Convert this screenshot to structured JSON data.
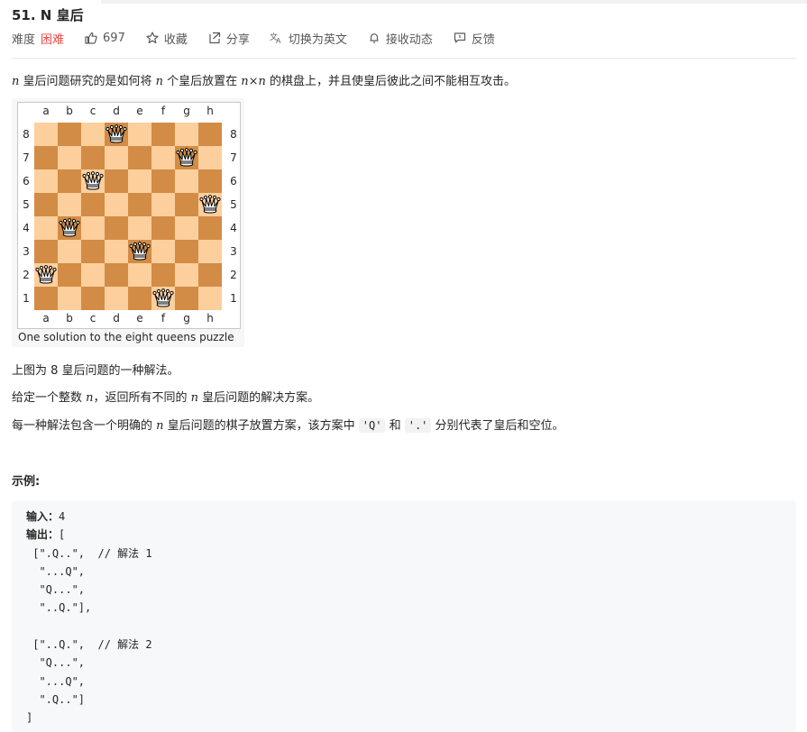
{
  "problem": {
    "title": "51. N 皇后",
    "difficulty_label": "难度",
    "difficulty_value": "困难",
    "likes": "697",
    "favorite": "收藏",
    "share": "分享",
    "translate": "切换为英文",
    "subscribe": "接收动态",
    "feedback": "反馈"
  },
  "description": {
    "p1_a": "n",
    "p1_b": " 皇后问题研究的是如何将 ",
    "p1_c": "n",
    "p1_d": " 个皇后放置在 ",
    "p1_e": "n×n",
    "p1_f": " 的棋盘上，并且使皇后彼此之间不能相互攻击。",
    "p2": "上图为 8 皇后问题的一种解法。",
    "p3_a": "给定一个整数 ",
    "p3_b": "n",
    "p3_c": "，返回所有不同的 ",
    "p3_d": "n",
    "p3_e": " 皇后问题的解决方案。",
    "p4_a": "每一种解法包含一个明确的 ",
    "p4_b": "n",
    "p4_c": " 皇后问题的棋子放置方案，该方案中 ",
    "p4_code1": "'Q'",
    "p4_d": " 和 ",
    "p4_code2": "'.'",
    "p4_e": " 分别代表了皇后和空位。"
  },
  "figure": {
    "files": [
      "a",
      "b",
      "c",
      "d",
      "e",
      "f",
      "g",
      "h"
    ],
    "ranks": [
      "8",
      "7",
      "6",
      "5",
      "4",
      "3",
      "2",
      "1"
    ],
    "queens": [
      {
        "file": "d",
        "rank": "8"
      },
      {
        "file": "g",
        "rank": "7"
      },
      {
        "file": "c",
        "rank": "6"
      },
      {
        "file": "h",
        "rank": "5"
      },
      {
        "file": "b",
        "rank": "4"
      },
      {
        "file": "e",
        "rank": "3"
      },
      {
        "file": "a",
        "rank": "2"
      },
      {
        "file": "f",
        "rank": "1"
      }
    ],
    "caption": "One solution to the eight queens puzzle",
    "light_color": "#fdcf9d",
    "dark_color": "#d28c45"
  },
  "example": {
    "heading": "示例:",
    "input_label": "输入：",
    "input_value": "4",
    "output_label": "输出：",
    "output_lines": [
      "[",
      " [\".Q..\",  // 解法 1",
      "  \"...Q\",",
      "  \"Q...\",",
      "  \"..Q.\"],",
      "",
      " [\"..Q.\",  // 解法 2",
      "  \"Q...\",",
      "  \"...Q\",",
      "  \".Q..\"]",
      "]"
    ]
  },
  "colors": {
    "hard": "#ef4743",
    "text": "#262626",
    "muted": "#595959"
  }
}
